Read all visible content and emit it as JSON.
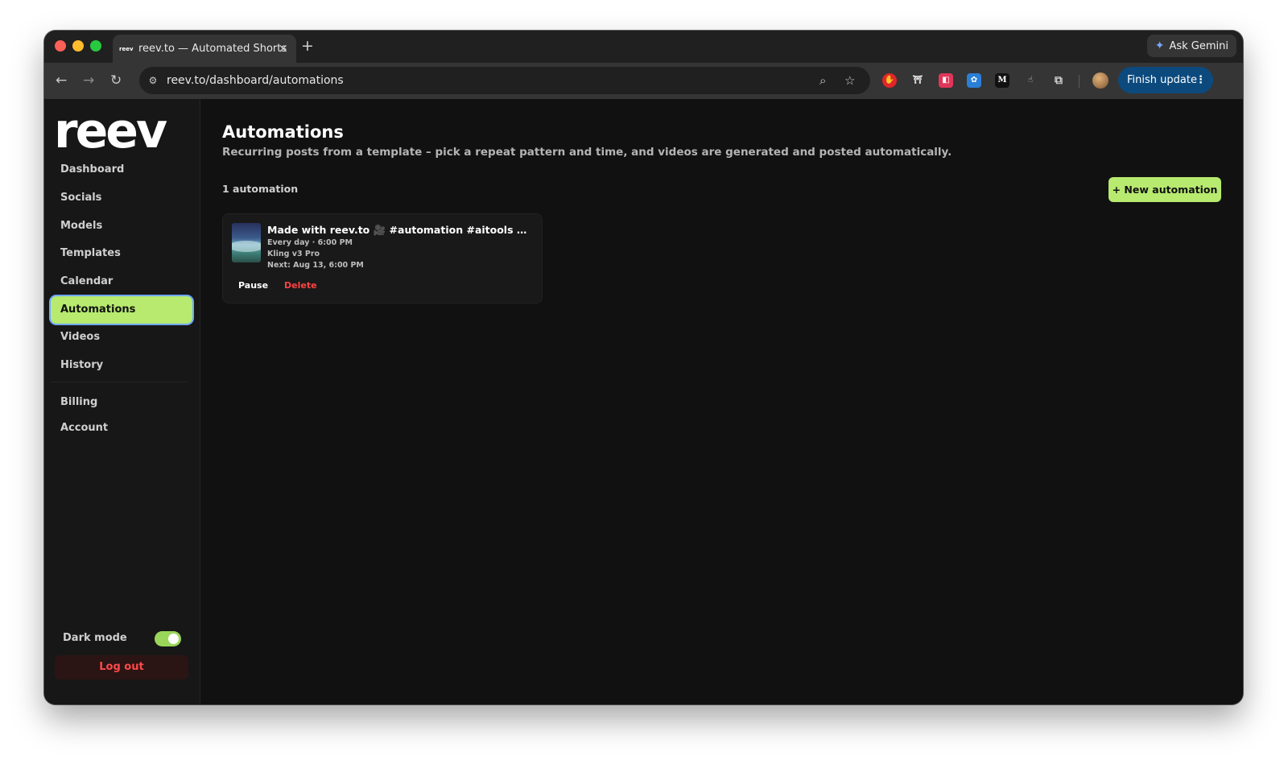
{
  "browser": {
    "tab_title": "reev.to — Automated Shorts",
    "tab_favicon": "reev",
    "tab_close": "×",
    "new_tab": "+",
    "ask_gemini": "Ask Gemini",
    "url": "reev.to/dashboard/automations",
    "finish_update": "Finish update",
    "menu_dots": "⋮",
    "back": "←",
    "forward": "→",
    "reload": "↻",
    "site_info": "⚙",
    "zoom": "⌕",
    "bookmark": "☆",
    "extensions": [
      "stop-sign-extension",
      "gift-extension",
      "red-square-extension",
      "paw-extension",
      "medium-extension",
      "hand-extension",
      "puzzle-extension"
    ],
    "extension_glyphs": [
      "✋",
      "🎁",
      "◧",
      "🐾",
      "M",
      "✋",
      "⧉"
    ]
  },
  "sidebar": {
    "logo": "reev",
    "items": [
      {
        "label": "Dashboard"
      },
      {
        "label": "Socials"
      },
      {
        "label": "Models"
      },
      {
        "label": "Templates"
      },
      {
        "label": "Calendar"
      },
      {
        "label": "Automations"
      },
      {
        "label": "Videos"
      },
      {
        "label": "History"
      },
      {
        "label": "Billing"
      },
      {
        "label": "Account"
      }
    ],
    "active": "Automations",
    "dark_mode_label": "Dark mode",
    "dark_mode_on": true,
    "logout": "Log out"
  },
  "main": {
    "title": "Automations",
    "subtitle": "Recurring posts from a template – pick a repeat pattern and time, and videos are generated and posted automatically.",
    "count": "1 automation",
    "new_button": "+ New automation",
    "automations": [
      {
        "title": "Made with reev.to 🎥 #automation #aitools #con...",
        "schedule": "Every day · 6:00 PM",
        "model": "Kling v3 Pro",
        "next": "Next: Aug 13, 6:00 PM",
        "pause": "Pause",
        "delete": "Delete"
      }
    ]
  },
  "colors": {
    "accent": "#b7ea6e",
    "danger": "#ff4242",
    "background": "#111111",
    "sidebar": "#171717"
  }
}
